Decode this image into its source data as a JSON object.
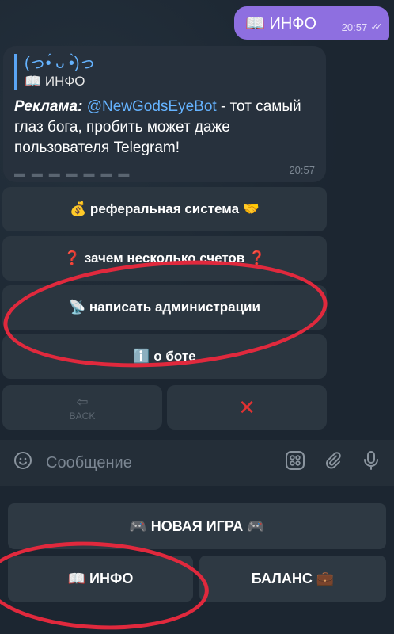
{
  "outgoing_message": {
    "text": "📖 ИНФО",
    "time": "20:57",
    "status": "read",
    "checks": "✓✓"
  },
  "incoming_message": {
    "quote_line1": "(っ•́ ᴗ •̀)っ",
    "quote_line2": "📖 ИНФО",
    "ad_label": "Реклама:",
    "ad_link": "@NewGodsEyeBot",
    "ad_text": " - тот самый глаз бога, пробить может даже пользователя Telegram!",
    "dashes": "▬ ▬ ▬ ▬ ▬ ▬ ▬",
    "time": "20:57"
  },
  "inline_keyboard": {
    "referral": "💰 реферальная система 🤝",
    "why_accounts": "❓ зачем несколько счетов ❓",
    "write_admin": "📡 написать администрации",
    "about_bot": "ℹ️ о боте",
    "back": "BACK",
    "close": "✕"
  },
  "input": {
    "placeholder": "Сообщение"
  },
  "icons": {
    "emoji": "emoji-icon",
    "bot_menu": "bot-menu-icon",
    "attach": "paperclip-icon",
    "mic": "mic-icon"
  },
  "reply_keyboard": {
    "new_game": "🎮 НОВАЯ ИГРА 🎮",
    "info": "📖 ИНФО",
    "balance": "БАЛАНС 💼"
  },
  "colors": {
    "accent": "#8e6fe0",
    "link": "#65b3ff",
    "annotation": "#e0293d"
  }
}
